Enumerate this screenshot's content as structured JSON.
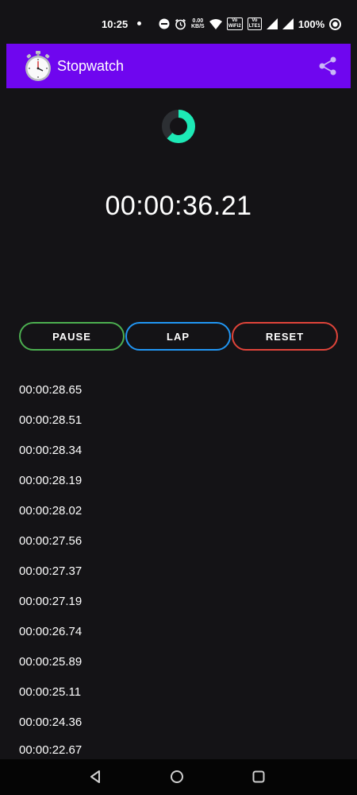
{
  "status_bar": {
    "time": "10:25",
    "net_speed_value": "0.00",
    "net_speed_unit": "KB/S",
    "volte1_top": "Vo",
    "volte1_bottom": "WiFi2",
    "volte2_top": "Vo",
    "volte2_bottom": "LTE1",
    "battery": "100%"
  },
  "app_bar": {
    "title": "Stopwatch",
    "color": "#6f06ef"
  },
  "progress_ring": {
    "fraction": 0.62,
    "accent": "#1de9b6",
    "track": "#2c2f33"
  },
  "timer": {
    "display": "00:00:36.21"
  },
  "controls": {
    "pause_label": "PAUSE",
    "lap_label": "LAP",
    "reset_label": "RESET",
    "pause_color": "#4caf50",
    "lap_color": "#2196f3",
    "reset_color": "#e0443a"
  },
  "laps": [
    "00:00:28.65",
    "00:00:28.51",
    "00:00:28.34",
    "00:00:28.19",
    "00:00:28.02",
    "00:00:27.56",
    "00:00:27.37",
    "00:00:27.19",
    "00:00:26.74",
    "00:00:25.89",
    "00:00:25.11",
    "00:00:24.36",
    "00:00:22.67"
  ],
  "icons": {
    "share": "share-icon",
    "back": "back-icon",
    "home": "home-icon",
    "recents": "recents-icon"
  }
}
